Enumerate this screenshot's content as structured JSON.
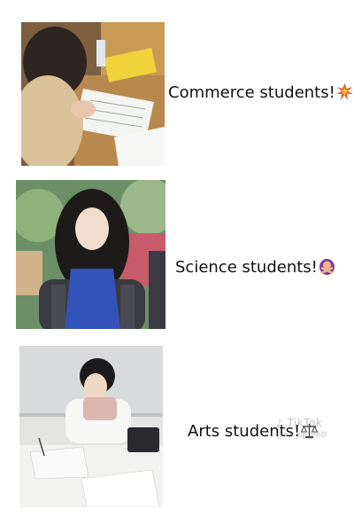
{
  "rows": [
    {
      "caption": "Commerce students!",
      "emoji": "collision-emoji"
    },
    {
      "caption": "Science students!",
      "emoji": "person-gesturing-no-emoji"
    },
    {
      "caption": "Arts students!",
      "emoji": "balance-scale-emoji"
    }
  ],
  "watermark": {
    "app": "TikTok",
    "user": "@sa_op_jm0"
  },
  "colors": {
    "background": "#ffffff",
    "text": "#111111"
  }
}
